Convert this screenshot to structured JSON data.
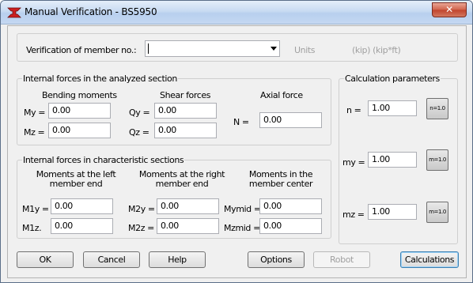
{
  "window": {
    "title": "Manual Verification - BS5950",
    "close_glyph": "✕"
  },
  "header": {
    "member_label": "Verification of member no.:",
    "member_value": "",
    "units_label": "Units",
    "units_value": "(kip) (kip*ft)"
  },
  "analyzed": {
    "title": "Internal forces in the analyzed section",
    "bending_title": "Bending moments",
    "shear_title": "Shear forces",
    "axial_title": "Axial force",
    "my_label": "My =",
    "my_value": "0.00",
    "mz_label": "Mz =",
    "mz_value": "0.00",
    "qy_label": "Qy =",
    "qy_value": "0.00",
    "qz_label": "Qz =",
    "qz_value": "0.00",
    "n_label": "N =",
    "n_value": "0.00"
  },
  "characteristic": {
    "title": "Internal forces in characteristic sections",
    "left_title_1": "Moments at the left",
    "left_title_2": "member end",
    "right_title_1": "Moments at the right",
    "right_title_2": "member end",
    "center_title_1": "Moments in the",
    "center_title_2": "member center",
    "m1y_label": "M1y =",
    "m1y_value": "0.00",
    "m1z_label": "M1z.",
    "m1z_value": "0.00",
    "m2y_label": "M2y =",
    "m2y_value": "0.00",
    "m2z_label": "M2z =",
    "m2z_value": "0.00",
    "mymid_label": "Mymid =",
    "mymid_value": "0.00",
    "mzmid_label": "Mzmid =",
    "mzmid_value": "0.00"
  },
  "params": {
    "title": "Calculation parameters",
    "n_label": "n =",
    "n_value": "1.00",
    "n_button": "n=1.0",
    "my_label": "my =",
    "my_value": "1.00",
    "my_button": "m=1.0",
    "mz_label": "mz =",
    "mz_value": "1.00",
    "mz_button": "m=1.0"
  },
  "buttons": {
    "ok": "OK",
    "cancel": "Cancel",
    "help": "Help",
    "options": "Options",
    "robot": "Robot",
    "calculations": "Calculations"
  },
  "colors": {
    "accent": "#3c7fb1",
    "close": "#c0432c",
    "icon_red": "#cc1f1f"
  }
}
